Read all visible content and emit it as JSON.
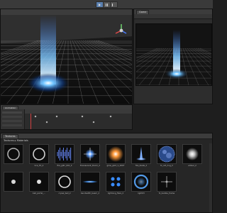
{
  "toolbar": {
    "play_label": "Play",
    "pause_label": "Pause",
    "step_label": "Step"
  },
  "game_view": {
    "tab": "Game"
  },
  "animation": {
    "tab": "Animation"
  },
  "textures": {
    "tab": "Textures",
    "path": "Textures ▸ Materials",
    "items": [
      {
        "label": "",
        "kind": "ring",
        "color": "#b0b0b0"
      },
      {
        "label": "bce_fct_2",
        "kind": "ring",
        "color": "#d0d0d0"
      },
      {
        "label": "fire_glitc_001_2",
        "kind": "wave",
        "color": "#6a8cff"
      },
      {
        "label": "Evanescent_Doom_2",
        "kind": "sparkle",
        "color": "#5a9cff"
      },
      {
        "label": "glow_glint_V_2007",
        "kind": "glow",
        "color": "#ff9a3a"
      },
      {
        "label": "fire_blade_2",
        "kind": "spike",
        "color": "#7fb0ff"
      },
      {
        "label": "fx_old_ring_V",
        "kind": "noise",
        "color": "#9ab8ff"
      },
      {
        "label": "ember_2",
        "kind": "soft",
        "color": "#c8c8c8"
      },
      {
        "label": "",
        "kind": "dot",
        "color": "#d8d8d8"
      },
      {
        "label": "ball_portal_...",
        "kind": "dot",
        "color": "#e0e0e0"
      },
      {
        "label": "crysal_ball_2",
        "kind": "ring",
        "color": "#e0e0e0"
      },
      {
        "label": "bandwidth_beam_2",
        "kind": "streak",
        "color": "#4a9cff"
      },
      {
        "label": "lightning_flare_2",
        "kind": "petals",
        "color": "#3a8cff"
      },
      {
        "label": "light03",
        "kind": "ringglow",
        "color": "#5aaaff"
      },
      {
        "label": "fx_bubble_frame",
        "kind": "cross",
        "color": "#b0b0b0"
      },
      {
        "label": "",
        "kind": "empty",
        "color": "#000000"
      }
    ]
  }
}
